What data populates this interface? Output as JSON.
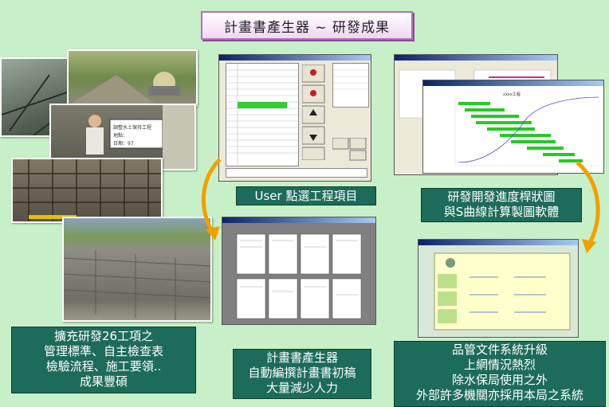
{
  "title": "計畫書產生器 ~ 研發成果",
  "captions": {
    "user_select": "User 點選工程項目",
    "gantt": [
      "研發開發進度桿狀圖",
      "與S曲線計算製圖軟體"
    ],
    "expand": [
      "擴充研發26工項之",
      "管理標準、自主檢查表",
      "檢驗流程、施工要領..",
      "成果豐碩"
    ],
    "generator": [
      "計畫書產生器",
      "自動編撰計畫書初稿",
      "大量減少人力"
    ],
    "quality": [
      "品管文件系統升級",
      "上網情況熱烈",
      "除水保局使用之外",
      "外部許多機關亦採用本局之系統"
    ]
  },
  "sign_text": [
    "調整水土保持工程",
    "地點：",
    "日期：97"
  ],
  "chart_title": "xxxx工程",
  "colors": {
    "caption_bg": "#1d6b5a",
    "bg": "#c8f0c8",
    "arrow": "#f0a000",
    "gantt_bar": "#22cc22"
  }
}
